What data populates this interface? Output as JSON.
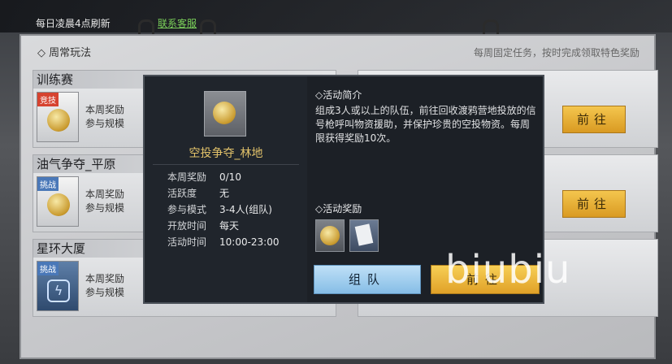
{
  "topbar": {
    "refresh_text": "每日凌晨4点刷新",
    "service_link": "联系客服"
  },
  "board": {
    "title": "周常玩法",
    "subtitle": "每周固定任务，按时完成领取特色奖励"
  },
  "cards": [
    {
      "name": "训练赛",
      "tag": "竞技",
      "line1": "本周奖励",
      "line2": "参与规模"
    },
    {
      "name": "油气争夺_平原",
      "tag": "挑战",
      "line1": "本周奖励",
      "line2": "参与规模"
    },
    {
      "name": "星环大厦",
      "tag": "挑战",
      "line1": "本周奖励",
      "line2": "参与规模"
    }
  ],
  "right_buttons": [
    {
      "label": "前往"
    },
    {
      "label": "前往"
    }
  ],
  "modal": {
    "activity_name": "空投争夺_林地",
    "info": [
      {
        "k": "本周奖励",
        "v": "0/10"
      },
      {
        "k": "活跃度",
        "v": "无"
      },
      {
        "k": "参与模式",
        "v": "3-4人(组队)"
      },
      {
        "k": "开放时间",
        "v": "每天"
      },
      {
        "k": "活动时间",
        "v": "10:00-23:00"
      }
    ],
    "intro_title": "活动简介",
    "intro_text": "组成3人或以上的队伍，前往回收渡鸦营地投放的信号枪呼叫物资援助，并保护珍贵的空投物资。每周限获得奖励10次。",
    "reward_title": "活动奖励",
    "team_button": "组队",
    "go_button": "前往"
  },
  "watermark": "biubiu",
  "colors": {
    "accent_gold": "#e2c26a",
    "button_gold": "#f4c64e",
    "button_blue": "#86bde6",
    "tag_red": "#d64330",
    "tag_blue": "#4a78b8"
  }
}
